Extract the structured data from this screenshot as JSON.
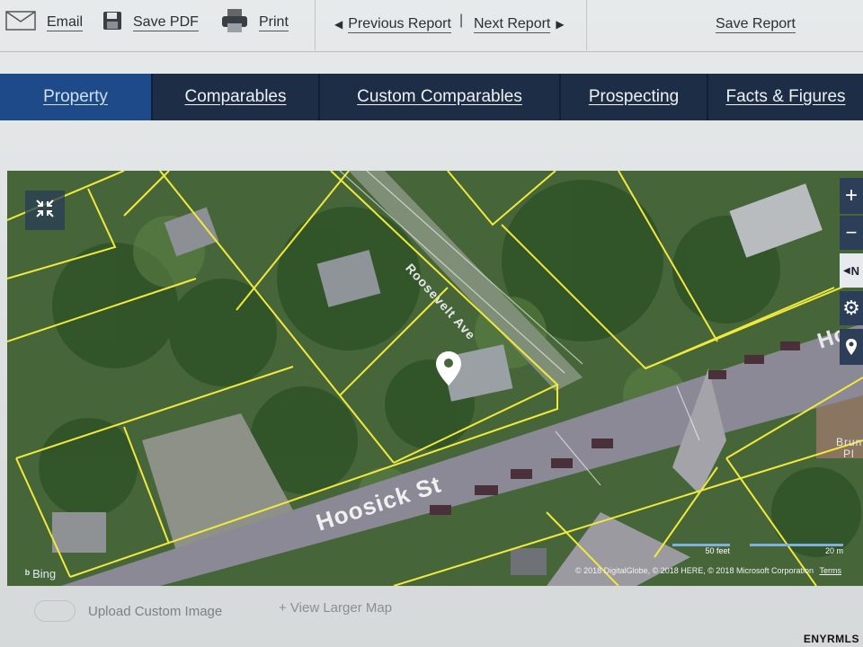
{
  "toolbar": {
    "email": "Email",
    "save_pdf": "Save PDF",
    "print": "Print",
    "previous_report": "Previous Report",
    "next_report": "Next Report",
    "save_report": "Save Report"
  },
  "nav": {
    "tabs": [
      "Property",
      "Comparables",
      "Custom Comparables",
      "Prospecting",
      "Facts & Figures"
    ],
    "active": "Property"
  },
  "map": {
    "streets": {
      "avenue": "Roosevelt Ave",
      "main": "Hoosick St",
      "main_edge": "Ho"
    },
    "corner_label": {
      "line1": "Brun",
      "line2": "Pl"
    },
    "controls": {
      "zoom_in": "+",
      "zoom_out": "−",
      "compass": "N"
    },
    "scale": {
      "feet": "50 feet",
      "meters": "20 m"
    },
    "attribution": "© 2018 DigitalGlobe, © 2018 HERE, © 2018 Microsoft Corporation",
    "terms": "Terms",
    "provider": "Bing",
    "parcel_line_color": "#f2ea3a",
    "pin_color": "#ffffff"
  },
  "bottom": {
    "upload_custom_image": "Upload Custom Image",
    "view_larger_map": "+ View Larger Map"
  },
  "watermark": "ENYRMLS"
}
